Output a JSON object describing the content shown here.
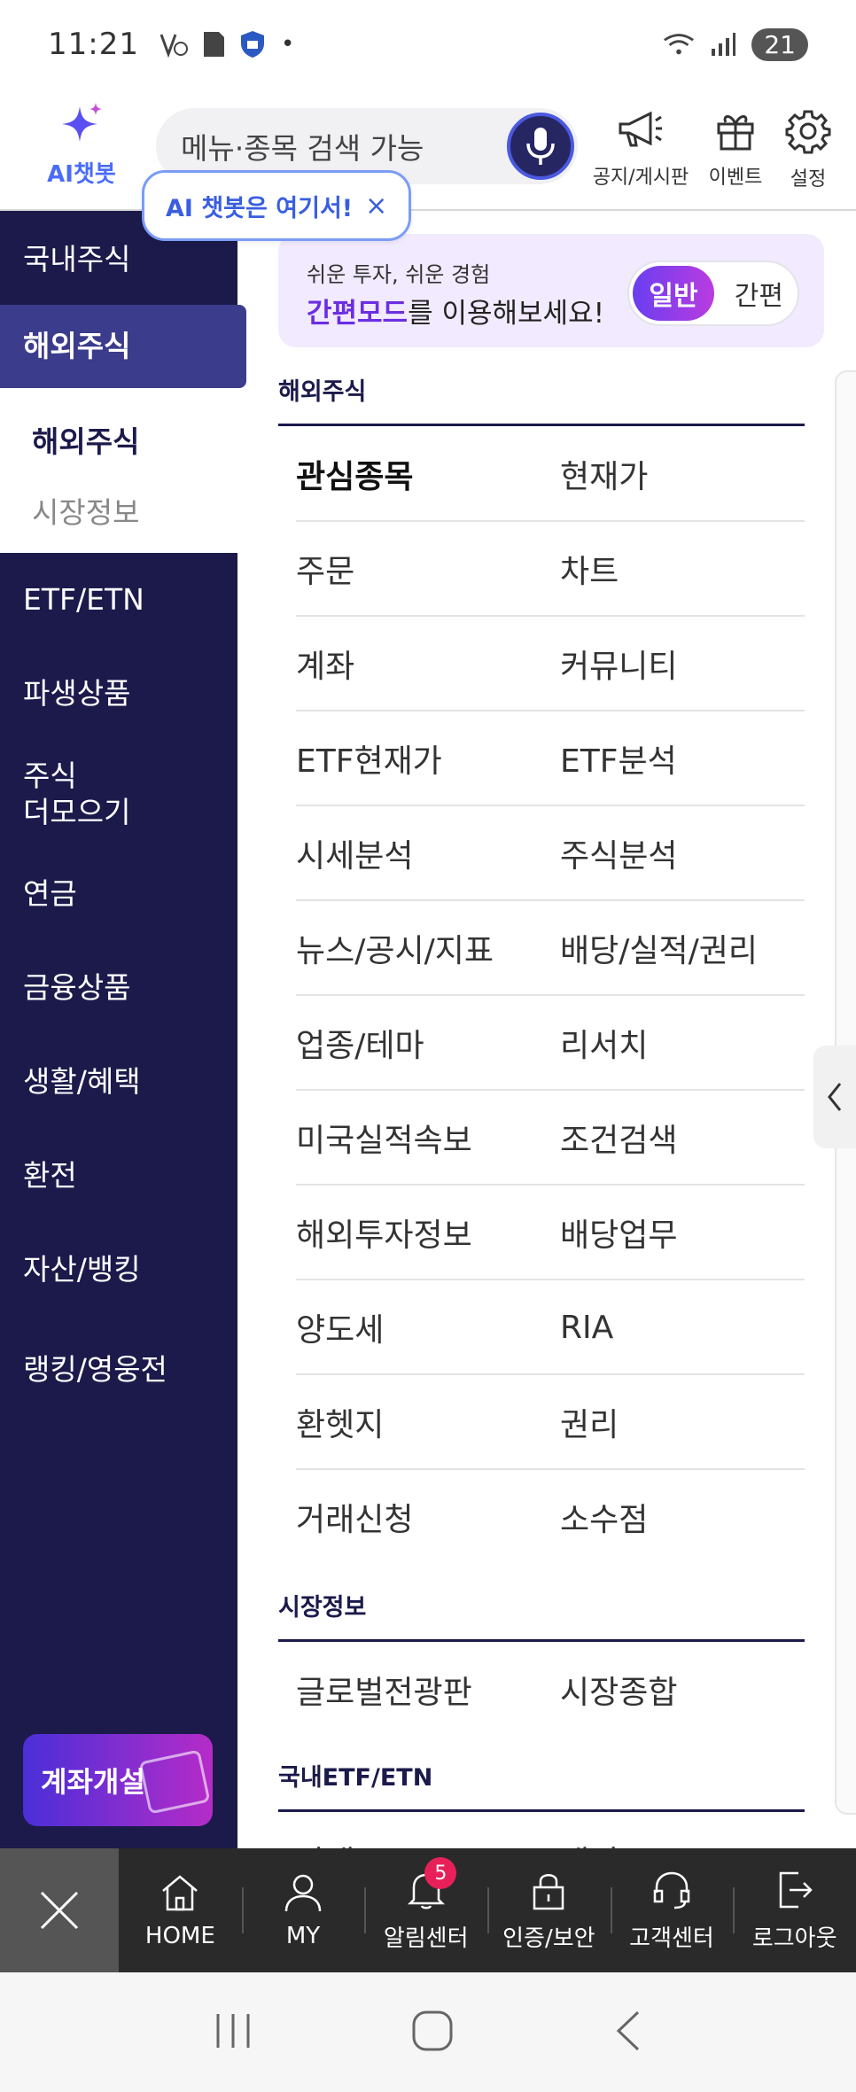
{
  "status_bar": {
    "time": "11:21",
    "battery": "21",
    "dot": "•"
  },
  "header": {
    "ai_chatbot_label": "AI챗봇",
    "search_placeholder": "메뉴·종목 검색 가능",
    "notice_label": "공지/게시판",
    "event_label": "이벤트",
    "settings_label": "설정",
    "tooltip_text": "AI 챗봇은 여기서!",
    "tooltip_close": "×"
  },
  "sidebar": {
    "items": [
      {
        "label": "국내주식"
      },
      {
        "label": "해외주식"
      },
      {
        "label": "ETF/ETN"
      },
      {
        "label": "파생상품"
      },
      {
        "label": "주식\n더모으기"
      },
      {
        "label": "연금"
      },
      {
        "label": "금융상품"
      },
      {
        "label": "생활/혜택"
      },
      {
        "label": "환전"
      },
      {
        "label": "자산/뱅킹"
      },
      {
        "label": "랭킹/영웅전"
      }
    ],
    "sub_items": [
      {
        "label": "해외주식"
      },
      {
        "label": "시장정보"
      }
    ],
    "open_account": "계좌개설"
  },
  "banner": {
    "small_text": "쉬운 투자, 쉬운 경험",
    "highlight": "간편모드",
    "rest": "를 이용해보세요!",
    "mode_on": "일반",
    "mode_off": "간편"
  },
  "sections": [
    {
      "title": "해외주식",
      "rows": [
        [
          "관심종목",
          "현재가"
        ],
        [
          "주문",
          "차트"
        ],
        [
          "계좌",
          "커뮤니티"
        ],
        [
          "ETF현재가",
          "ETF분석"
        ],
        [
          "시세분석",
          "주식분석"
        ],
        [
          "뉴스/공시/지표",
          "배당/실적/권리"
        ],
        [
          "업종/테마",
          "리서치"
        ],
        [
          "미국실적속보",
          "조건검색"
        ],
        [
          "해외투자정보",
          "배당업무"
        ],
        [
          "양도세",
          "RIA"
        ],
        [
          "환헷지",
          "권리"
        ],
        [
          "거래신청",
          "소수점"
        ]
      ]
    },
    {
      "title": "시장정보",
      "rows": [
        [
          "글로벌전광판",
          "시장종합"
        ]
      ]
    },
    {
      "title": "국내ETF/ETN",
      "rows": [
        [
          "단새",
          "개기"
        ]
      ]
    }
  ],
  "bottom_nav": {
    "items": [
      {
        "label": "HOME"
      },
      {
        "label": "MY"
      },
      {
        "label": "알림센터",
        "badge": "5"
      },
      {
        "label": "인증/보안"
      },
      {
        "label": "고객센터"
      },
      {
        "label": "로그아웃"
      }
    ]
  }
}
